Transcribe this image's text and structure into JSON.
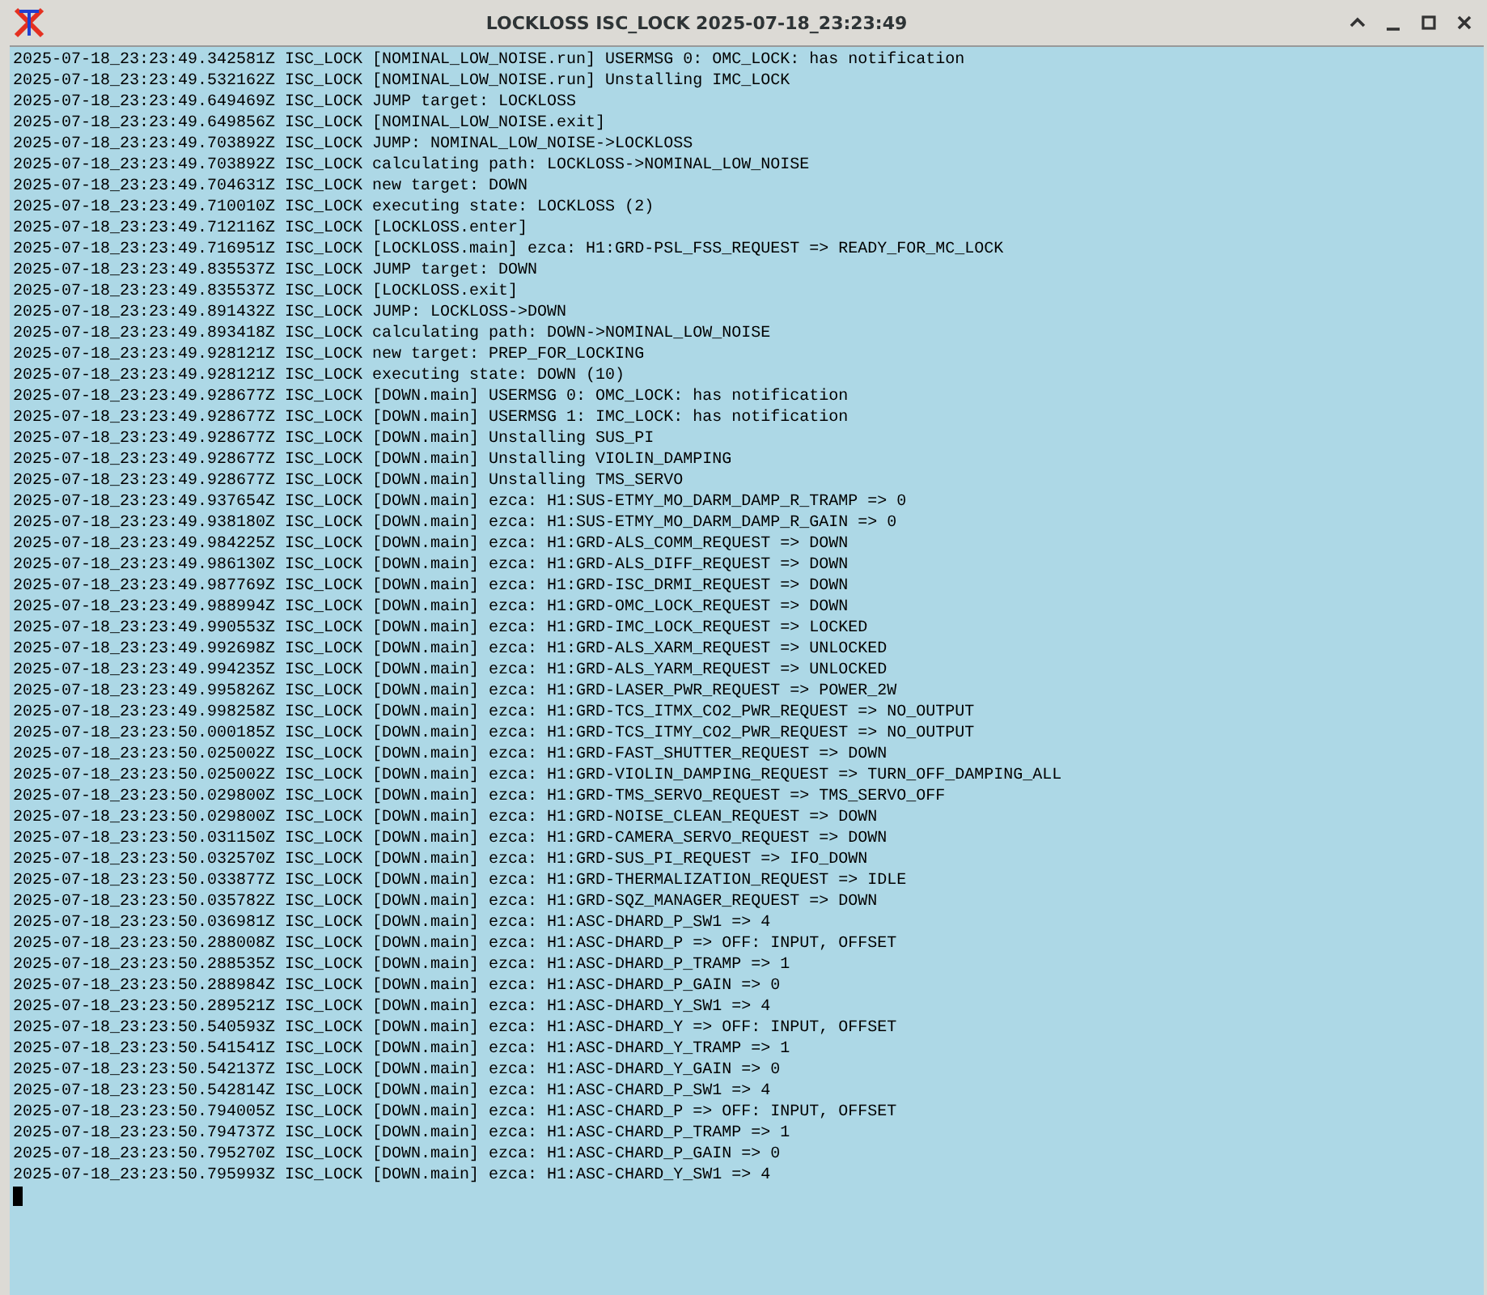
{
  "window": {
    "title": "LOCKLOSS ISC_LOCK 2025-07-18_23:23:49"
  },
  "terminal": {
    "cursor": true,
    "lines": [
      "2025-07-18_23:23:49.342581Z ISC_LOCK [NOMINAL_LOW_NOISE.run] USERMSG 0: OMC_LOCK: has notification",
      "2025-07-18_23:23:49.532162Z ISC_LOCK [NOMINAL_LOW_NOISE.run] Unstalling IMC_LOCK",
      "2025-07-18_23:23:49.649469Z ISC_LOCK JUMP target: LOCKLOSS",
      "2025-07-18_23:23:49.649856Z ISC_LOCK [NOMINAL_LOW_NOISE.exit]",
      "2025-07-18_23:23:49.703892Z ISC_LOCK JUMP: NOMINAL_LOW_NOISE->LOCKLOSS",
      "2025-07-18_23:23:49.703892Z ISC_LOCK calculating path: LOCKLOSS->NOMINAL_LOW_NOISE",
      "2025-07-18_23:23:49.704631Z ISC_LOCK new target: DOWN",
      "2025-07-18_23:23:49.710010Z ISC_LOCK executing state: LOCKLOSS (2)",
      "2025-07-18_23:23:49.712116Z ISC_LOCK [LOCKLOSS.enter]",
      "2025-07-18_23:23:49.716951Z ISC_LOCK [LOCKLOSS.main] ezca: H1:GRD-PSL_FSS_REQUEST => READY_FOR_MC_LOCK",
      "2025-07-18_23:23:49.835537Z ISC_LOCK JUMP target: DOWN",
      "2025-07-18_23:23:49.835537Z ISC_LOCK [LOCKLOSS.exit]",
      "2025-07-18_23:23:49.891432Z ISC_LOCK JUMP: LOCKLOSS->DOWN",
      "2025-07-18_23:23:49.893418Z ISC_LOCK calculating path: DOWN->NOMINAL_LOW_NOISE",
      "2025-07-18_23:23:49.928121Z ISC_LOCK new target: PREP_FOR_LOCKING",
      "2025-07-18_23:23:49.928121Z ISC_LOCK executing state: DOWN (10)",
      "2025-07-18_23:23:49.928677Z ISC_LOCK [DOWN.main] USERMSG 0: OMC_LOCK: has notification",
      "2025-07-18_23:23:49.928677Z ISC_LOCK [DOWN.main] USERMSG 1: IMC_LOCK: has notification",
      "2025-07-18_23:23:49.928677Z ISC_LOCK [DOWN.main] Unstalling SUS_PI",
      "2025-07-18_23:23:49.928677Z ISC_LOCK [DOWN.main] Unstalling VIOLIN_DAMPING",
      "2025-07-18_23:23:49.928677Z ISC_LOCK [DOWN.main] Unstalling TMS_SERVO",
      "2025-07-18_23:23:49.937654Z ISC_LOCK [DOWN.main] ezca: H1:SUS-ETMY_MO_DARM_DAMP_R_TRAMP => 0",
      "2025-07-18_23:23:49.938180Z ISC_LOCK [DOWN.main] ezca: H1:SUS-ETMY_MO_DARM_DAMP_R_GAIN => 0",
      "2025-07-18_23:23:49.984225Z ISC_LOCK [DOWN.main] ezca: H1:GRD-ALS_COMM_REQUEST => DOWN",
      "2025-07-18_23:23:49.986130Z ISC_LOCK [DOWN.main] ezca: H1:GRD-ALS_DIFF_REQUEST => DOWN",
      "2025-07-18_23:23:49.987769Z ISC_LOCK [DOWN.main] ezca: H1:GRD-ISC_DRMI_REQUEST => DOWN",
      "2025-07-18_23:23:49.988994Z ISC_LOCK [DOWN.main] ezca: H1:GRD-OMC_LOCK_REQUEST => DOWN",
      "2025-07-18_23:23:49.990553Z ISC_LOCK [DOWN.main] ezca: H1:GRD-IMC_LOCK_REQUEST => LOCKED",
      "2025-07-18_23:23:49.992698Z ISC_LOCK [DOWN.main] ezca: H1:GRD-ALS_XARM_REQUEST => UNLOCKED",
      "2025-07-18_23:23:49.994235Z ISC_LOCK [DOWN.main] ezca: H1:GRD-ALS_YARM_REQUEST => UNLOCKED",
      "2025-07-18_23:23:49.995826Z ISC_LOCK [DOWN.main] ezca: H1:GRD-LASER_PWR_REQUEST => POWER_2W",
      "2025-07-18_23:23:49.998258Z ISC_LOCK [DOWN.main] ezca: H1:GRD-TCS_ITMX_CO2_PWR_REQUEST => NO_OUTPUT",
      "2025-07-18_23:23:50.000185Z ISC_LOCK [DOWN.main] ezca: H1:GRD-TCS_ITMY_CO2_PWR_REQUEST => NO_OUTPUT",
      "2025-07-18_23:23:50.025002Z ISC_LOCK [DOWN.main] ezca: H1:GRD-FAST_SHUTTER_REQUEST => DOWN",
      "2025-07-18_23:23:50.025002Z ISC_LOCK [DOWN.main] ezca: H1:GRD-VIOLIN_DAMPING_REQUEST => TURN_OFF_DAMPING_ALL",
      "2025-07-18_23:23:50.029800Z ISC_LOCK [DOWN.main] ezca: H1:GRD-TMS_SERVO_REQUEST => TMS_SERVO_OFF",
      "2025-07-18_23:23:50.029800Z ISC_LOCK [DOWN.main] ezca: H1:GRD-NOISE_CLEAN_REQUEST => DOWN",
      "2025-07-18_23:23:50.031150Z ISC_LOCK [DOWN.main] ezca: H1:GRD-CAMERA_SERVO_REQUEST => DOWN",
      "2025-07-18_23:23:50.032570Z ISC_LOCK [DOWN.main] ezca: H1:GRD-SUS_PI_REQUEST => IFO_DOWN",
      "2025-07-18_23:23:50.033877Z ISC_LOCK [DOWN.main] ezca: H1:GRD-THERMALIZATION_REQUEST => IDLE",
      "2025-07-18_23:23:50.035782Z ISC_LOCK [DOWN.main] ezca: H1:GRD-SQZ_MANAGER_REQUEST => DOWN",
      "2025-07-18_23:23:50.036981Z ISC_LOCK [DOWN.main] ezca: H1:ASC-DHARD_P_SW1 => 4",
      "2025-07-18_23:23:50.288008Z ISC_LOCK [DOWN.main] ezca: H1:ASC-DHARD_P => OFF: INPUT, OFFSET",
      "2025-07-18_23:23:50.288535Z ISC_LOCK [DOWN.main] ezca: H1:ASC-DHARD_P_TRAMP => 1",
      "2025-07-18_23:23:50.288984Z ISC_LOCK [DOWN.main] ezca: H1:ASC-DHARD_P_GAIN => 0",
      "2025-07-18_23:23:50.289521Z ISC_LOCK [DOWN.main] ezca: H1:ASC-DHARD_Y_SW1 => 4",
      "2025-07-18_23:23:50.540593Z ISC_LOCK [DOWN.main] ezca: H1:ASC-DHARD_Y => OFF: INPUT, OFFSET",
      "2025-07-18_23:23:50.541541Z ISC_LOCK [DOWN.main] ezca: H1:ASC-DHARD_Y_TRAMP => 1",
      "2025-07-18_23:23:50.542137Z ISC_LOCK [DOWN.main] ezca: H1:ASC-DHARD_Y_GAIN => 0",
      "2025-07-18_23:23:50.542814Z ISC_LOCK [DOWN.main] ezca: H1:ASC-CHARD_P_SW1 => 4",
      "2025-07-18_23:23:50.794005Z ISC_LOCK [DOWN.main] ezca: H1:ASC-CHARD_P => OFF: INPUT, OFFSET",
      "2025-07-18_23:23:50.794737Z ISC_LOCK [DOWN.main] ezca: H1:ASC-CHARD_P_TRAMP => 1",
      "2025-07-18_23:23:50.795270Z ISC_LOCK [DOWN.main] ezca: H1:ASC-CHARD_P_GAIN => 0",
      "2025-07-18_23:23:50.795993Z ISC_LOCK [DOWN.main] ezca: H1:ASC-CHARD_Y_SW1 => 4"
    ]
  }
}
